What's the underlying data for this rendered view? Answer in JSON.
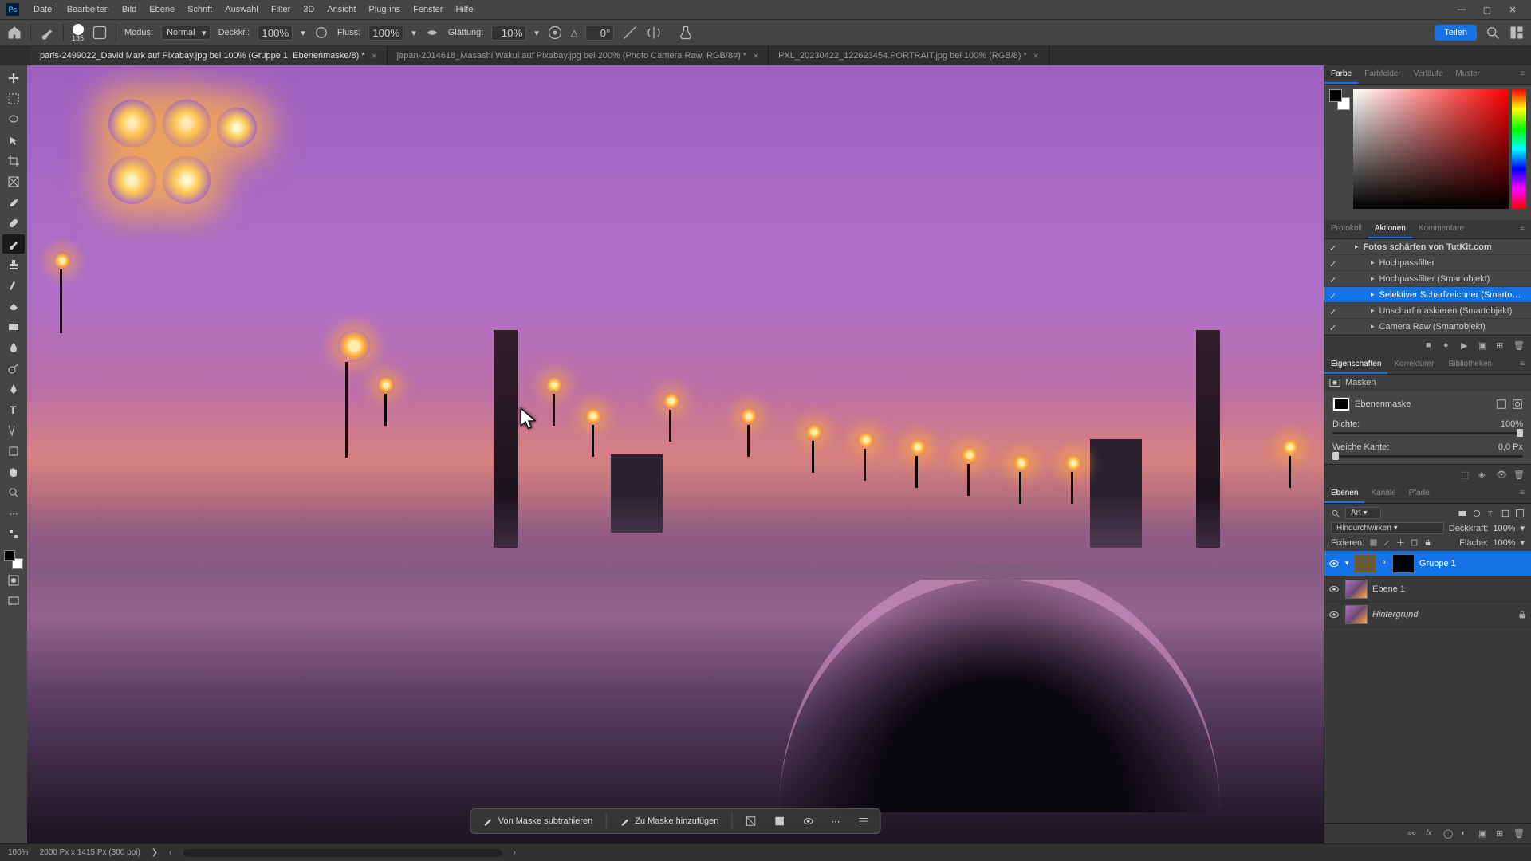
{
  "menu": [
    "Datei",
    "Bearbeiten",
    "Bild",
    "Ebene",
    "Schrift",
    "Auswahl",
    "Filter",
    "3D",
    "Ansicht",
    "Plug-ins",
    "Fenster",
    "Hilfe"
  ],
  "options": {
    "brush_size": "135",
    "mode_label": "Modus:",
    "mode_value": "Normal",
    "opacity_label": "Deckkr.:",
    "opacity_value": "100%",
    "flow_label": "Fluss:",
    "flow_value": "100%",
    "smoothing_label": "Glättung:",
    "smoothing_value": "10%",
    "angle_icon_label": "△",
    "angle_value": "0°",
    "share": "Teilen"
  },
  "tabs": [
    {
      "label": "paris-2499022_David Mark auf Pixabay.jpg bei 100% (Gruppe 1, Ebenenmaske/8) *",
      "active": true
    },
    {
      "label": "japan-2014618_Masashi Wakui auf Pixabay.jpg bei 200% (Photo Camera Raw, RGB/8#) *",
      "active": false
    },
    {
      "label": "PXL_20230422_122623454.PORTRAIT.jpg bei 100% (RGB/8) *",
      "active": false
    }
  ],
  "contextbar": {
    "subtract": "Von Maske subtrahieren",
    "add": "Zu Maske hinzufügen"
  },
  "panels": {
    "color_tabs": [
      "Farbe",
      "Farbfelder",
      "Verläufe",
      "Muster"
    ],
    "history_tabs": [
      "Protokoll",
      "Aktionen",
      "Kommentare"
    ],
    "actions": [
      {
        "label": "Fotos schärfen von TutKit.com",
        "bold": true,
        "indent": 0,
        "selected": false
      },
      {
        "label": "Hochpassfilter",
        "indent": 1,
        "selected": false
      },
      {
        "label": "Hochpassfilter (Smartobjekt)",
        "indent": 1,
        "selected": false
      },
      {
        "label": "Selektiver Scharfzeichner (Smarto…",
        "indent": 1,
        "selected": true
      },
      {
        "label": "Unscharf maskieren (Smartobjekt)",
        "indent": 1,
        "selected": false
      },
      {
        "label": "Camera Raw (Smartobjekt)",
        "indent": 1,
        "selected": false
      }
    ],
    "props_tabs": [
      "Eigenschaften",
      "Korrekturen",
      "Bibliotheken"
    ],
    "props": {
      "mask_label": "Masken",
      "mask_type": "Ebenenmaske",
      "density_label": "Dichte:",
      "density_value": "100%",
      "feather_label": "Weiche Kante:",
      "feather_value": "0,0 Px"
    },
    "layers_tabs": [
      "Ebenen",
      "Kanäle",
      "Pfade"
    ],
    "layers": {
      "search_placeholder": "Art",
      "blend": "Hindurchwirken",
      "opacity_label": "Deckkraft:",
      "opacity_value": "100%",
      "lock_label": "Fixieren:",
      "fill_label": "Fläche:",
      "fill_value": "100%",
      "rows": [
        {
          "name": "Gruppe 1",
          "selected": true,
          "type": "group",
          "mask": true
        },
        {
          "name": "Ebene 1",
          "selected": false,
          "type": "layer"
        },
        {
          "name": "Hintergrund",
          "selected": false,
          "type": "bg",
          "locked": true
        }
      ]
    }
  },
  "status": {
    "zoom": "100%",
    "info": "2000 Px x 1415 Px (300 ppi)"
  }
}
